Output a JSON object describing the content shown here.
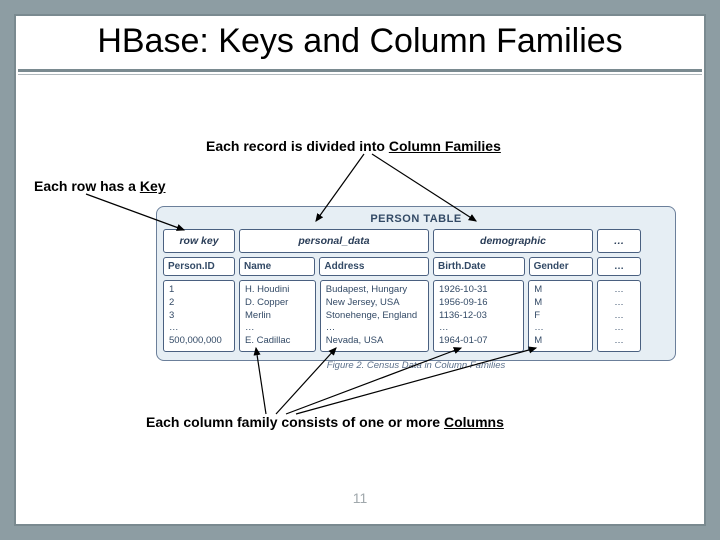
{
  "title": "HBase: Keys and Column Families",
  "caption_cf_prefix": "Each record is divided into ",
  "caption_cf_term": "Column Families",
  "caption_key_prefix": "Each row has a ",
  "caption_key_term": "Key",
  "caption_cols_prefix": "Each column family consists of one or more ",
  "caption_cols_term": "Columns",
  "page_number": "11",
  "diagram": {
    "table_title": "PERSON TABLE",
    "figure_caption": "Figure 2. Census Data in Column Families",
    "headers": {
      "row_key": "row key",
      "personal_data": "personal_data",
      "demographic": "demographic",
      "ellipsis": "…"
    },
    "subheaders": {
      "person_id": "Person.ID",
      "name": "Name",
      "address": "Address",
      "birth_date": "Birth.Date",
      "gender": "Gender",
      "ellipsis": "…"
    },
    "rows": {
      "person_id": [
        "1",
        "2",
        "3",
        "…",
        "500,000,000"
      ],
      "name": [
        "H. Houdini",
        "D. Copper",
        "Merlin",
        "…",
        "E. Cadillac"
      ],
      "address": [
        "Budapest, Hungary",
        "New Jersey, USA",
        "Stonehenge, England",
        "…",
        "Nevada, USA"
      ],
      "birth_date": [
        "1926-10-31",
        "1956-09-16",
        "1136-12-03",
        "…",
        "1964-01-07"
      ],
      "gender": [
        "M",
        "M",
        "F",
        "…",
        "M"
      ],
      "ellipsis": [
        "…",
        "…",
        "…",
        "…",
        "…"
      ]
    }
  }
}
